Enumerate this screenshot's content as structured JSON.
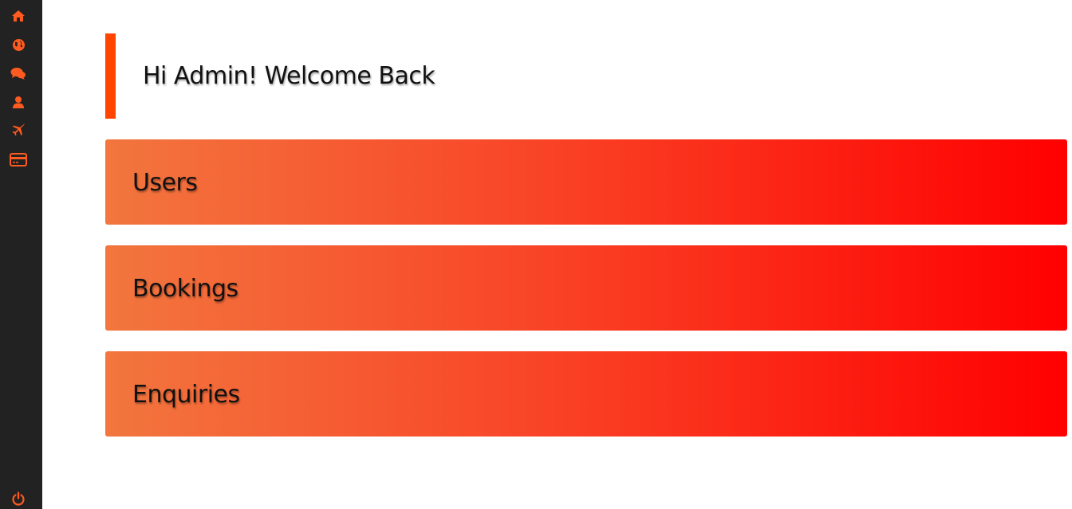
{
  "sidebar": {
    "accent": "#ff5a1f",
    "background": "#222222",
    "items": [
      {
        "icon": "home-icon"
      },
      {
        "icon": "globe-icon"
      },
      {
        "icon": "comments-icon"
      },
      {
        "icon": "user-icon"
      },
      {
        "icon": "plane-icon"
      },
      {
        "icon": "credit-card-icon"
      }
    ],
    "footer_icon": "power-icon"
  },
  "header": {
    "welcome": "Hi Admin! Welcome Back",
    "accent": "#ff4500"
  },
  "cards": [
    {
      "label": "Users"
    },
    {
      "label": "Bookings"
    },
    {
      "label": "Enquiries"
    }
  ],
  "card_gradient": {
    "start": "#f2763e",
    "end": "#ff0000"
  }
}
